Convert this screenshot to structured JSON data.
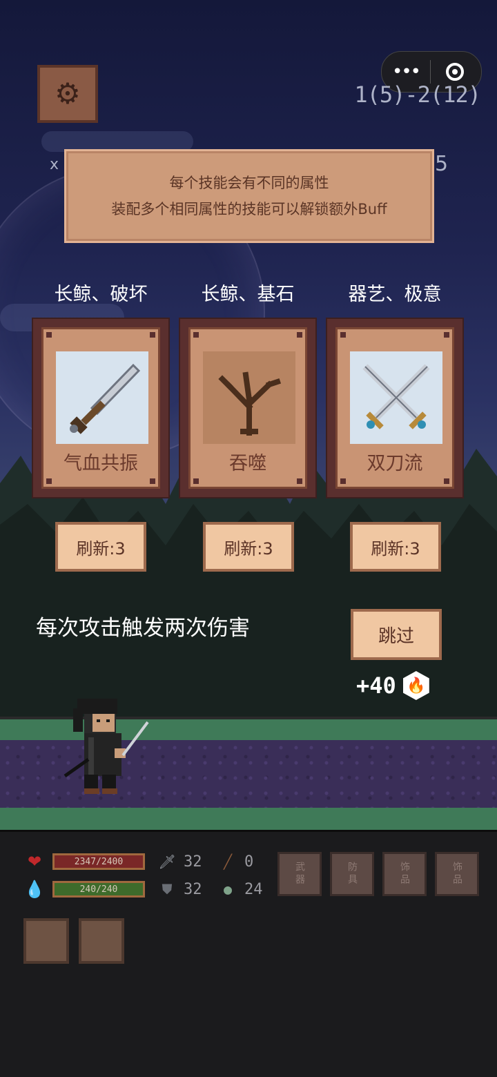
{
  "hud": {
    "stage": "1(5)-2(12)",
    "left_marker": "x",
    "right_marker": "5",
    "menu_dots": "•••"
  },
  "tip": {
    "line1": "每个技能会有不同的属性",
    "line2": "装配多个相同属性的技能可以解锁额外Buff"
  },
  "skills": [
    {
      "tags": "长鲸、破坏",
      "name": "气血共振",
      "refresh": "刷新:3",
      "icon": "sword-icon"
    },
    {
      "tags": "长鲸、基石",
      "name": "吞噬",
      "refresh": "刷新:3",
      "icon": "dead-tree-icon"
    },
    {
      "tags": "器艺、极意",
      "name": "双刀流",
      "refresh": "刷新:3",
      "icon": "crossed-swords-icon"
    }
  ],
  "selected_description": "每次攻击触发两次伤害",
  "skip_label": "跳过",
  "reward": {
    "amount": "+40",
    "icon": "fire-icon"
  },
  "player": {
    "hp": "2347/2400",
    "mp": "240/240",
    "attack": "32",
    "defense": "32",
    "stat3": "0",
    "stat4": "24"
  },
  "equipment": [
    {
      "label": "武器"
    },
    {
      "label": "防具"
    },
    {
      "label": "饰品"
    },
    {
      "label": "饰品"
    }
  ],
  "colors": {
    "panel": "#cd9b7a",
    "card_border": "#5a2f2e",
    "button": "#f0c7a2",
    "hp_bar": "#7a2727",
    "mp_bar": "#3e6b2b"
  }
}
